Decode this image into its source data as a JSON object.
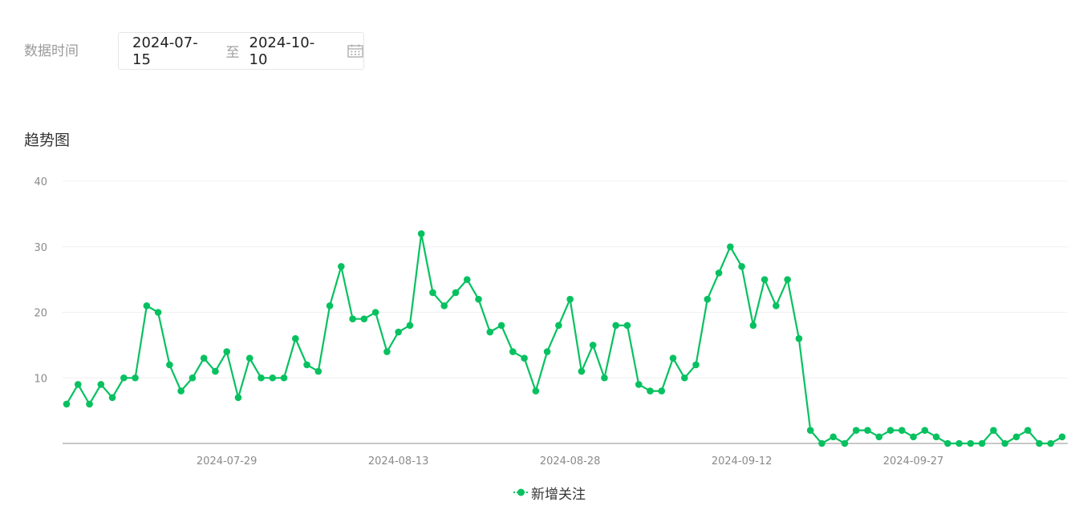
{
  "filter": {
    "label": "数据时间",
    "start_date": "2024-07-15",
    "separator": "至",
    "end_date": "2024-10-10",
    "icon": "calendar-icon"
  },
  "section_title": "趋势图",
  "colors": {
    "series": "#07c160",
    "grid": "#f0f0f0",
    "axis": "#c8c8c8"
  },
  "chart_data": {
    "type": "line",
    "title": "",
    "xlabel": "",
    "ylabel": "",
    "ylim": [
      0,
      40
    ],
    "yticks": [
      10,
      20,
      30,
      40
    ],
    "x_tick_labels": [
      "2024-07-29",
      "2024-08-13",
      "2024-08-28",
      "2024-09-12",
      "2024-09-27"
    ],
    "x_start": "2024-07-15",
    "x_end": "2024-10-10",
    "grid": true,
    "legend_position": "bottom-center",
    "series": [
      {
        "name": "新增关注",
        "values": [
          6,
          9,
          6,
          9,
          7,
          10,
          10,
          21,
          20,
          12,
          8,
          10,
          13,
          11,
          14,
          7,
          13,
          10,
          10,
          10,
          16,
          12,
          11,
          21,
          27,
          19,
          19,
          20,
          14,
          17,
          18,
          32,
          23,
          21,
          23,
          25,
          22,
          17,
          18,
          14,
          13,
          8,
          14,
          18,
          22,
          11,
          15,
          10,
          18,
          18,
          9,
          8,
          8,
          13,
          10,
          12,
          22,
          26,
          30,
          27,
          18,
          25,
          21,
          25,
          16,
          2,
          0,
          1,
          0,
          2,
          2,
          1,
          2,
          2,
          1,
          2,
          1,
          0,
          0,
          0,
          0,
          2,
          0,
          1,
          2,
          0,
          0,
          1
        ]
      }
    ]
  }
}
